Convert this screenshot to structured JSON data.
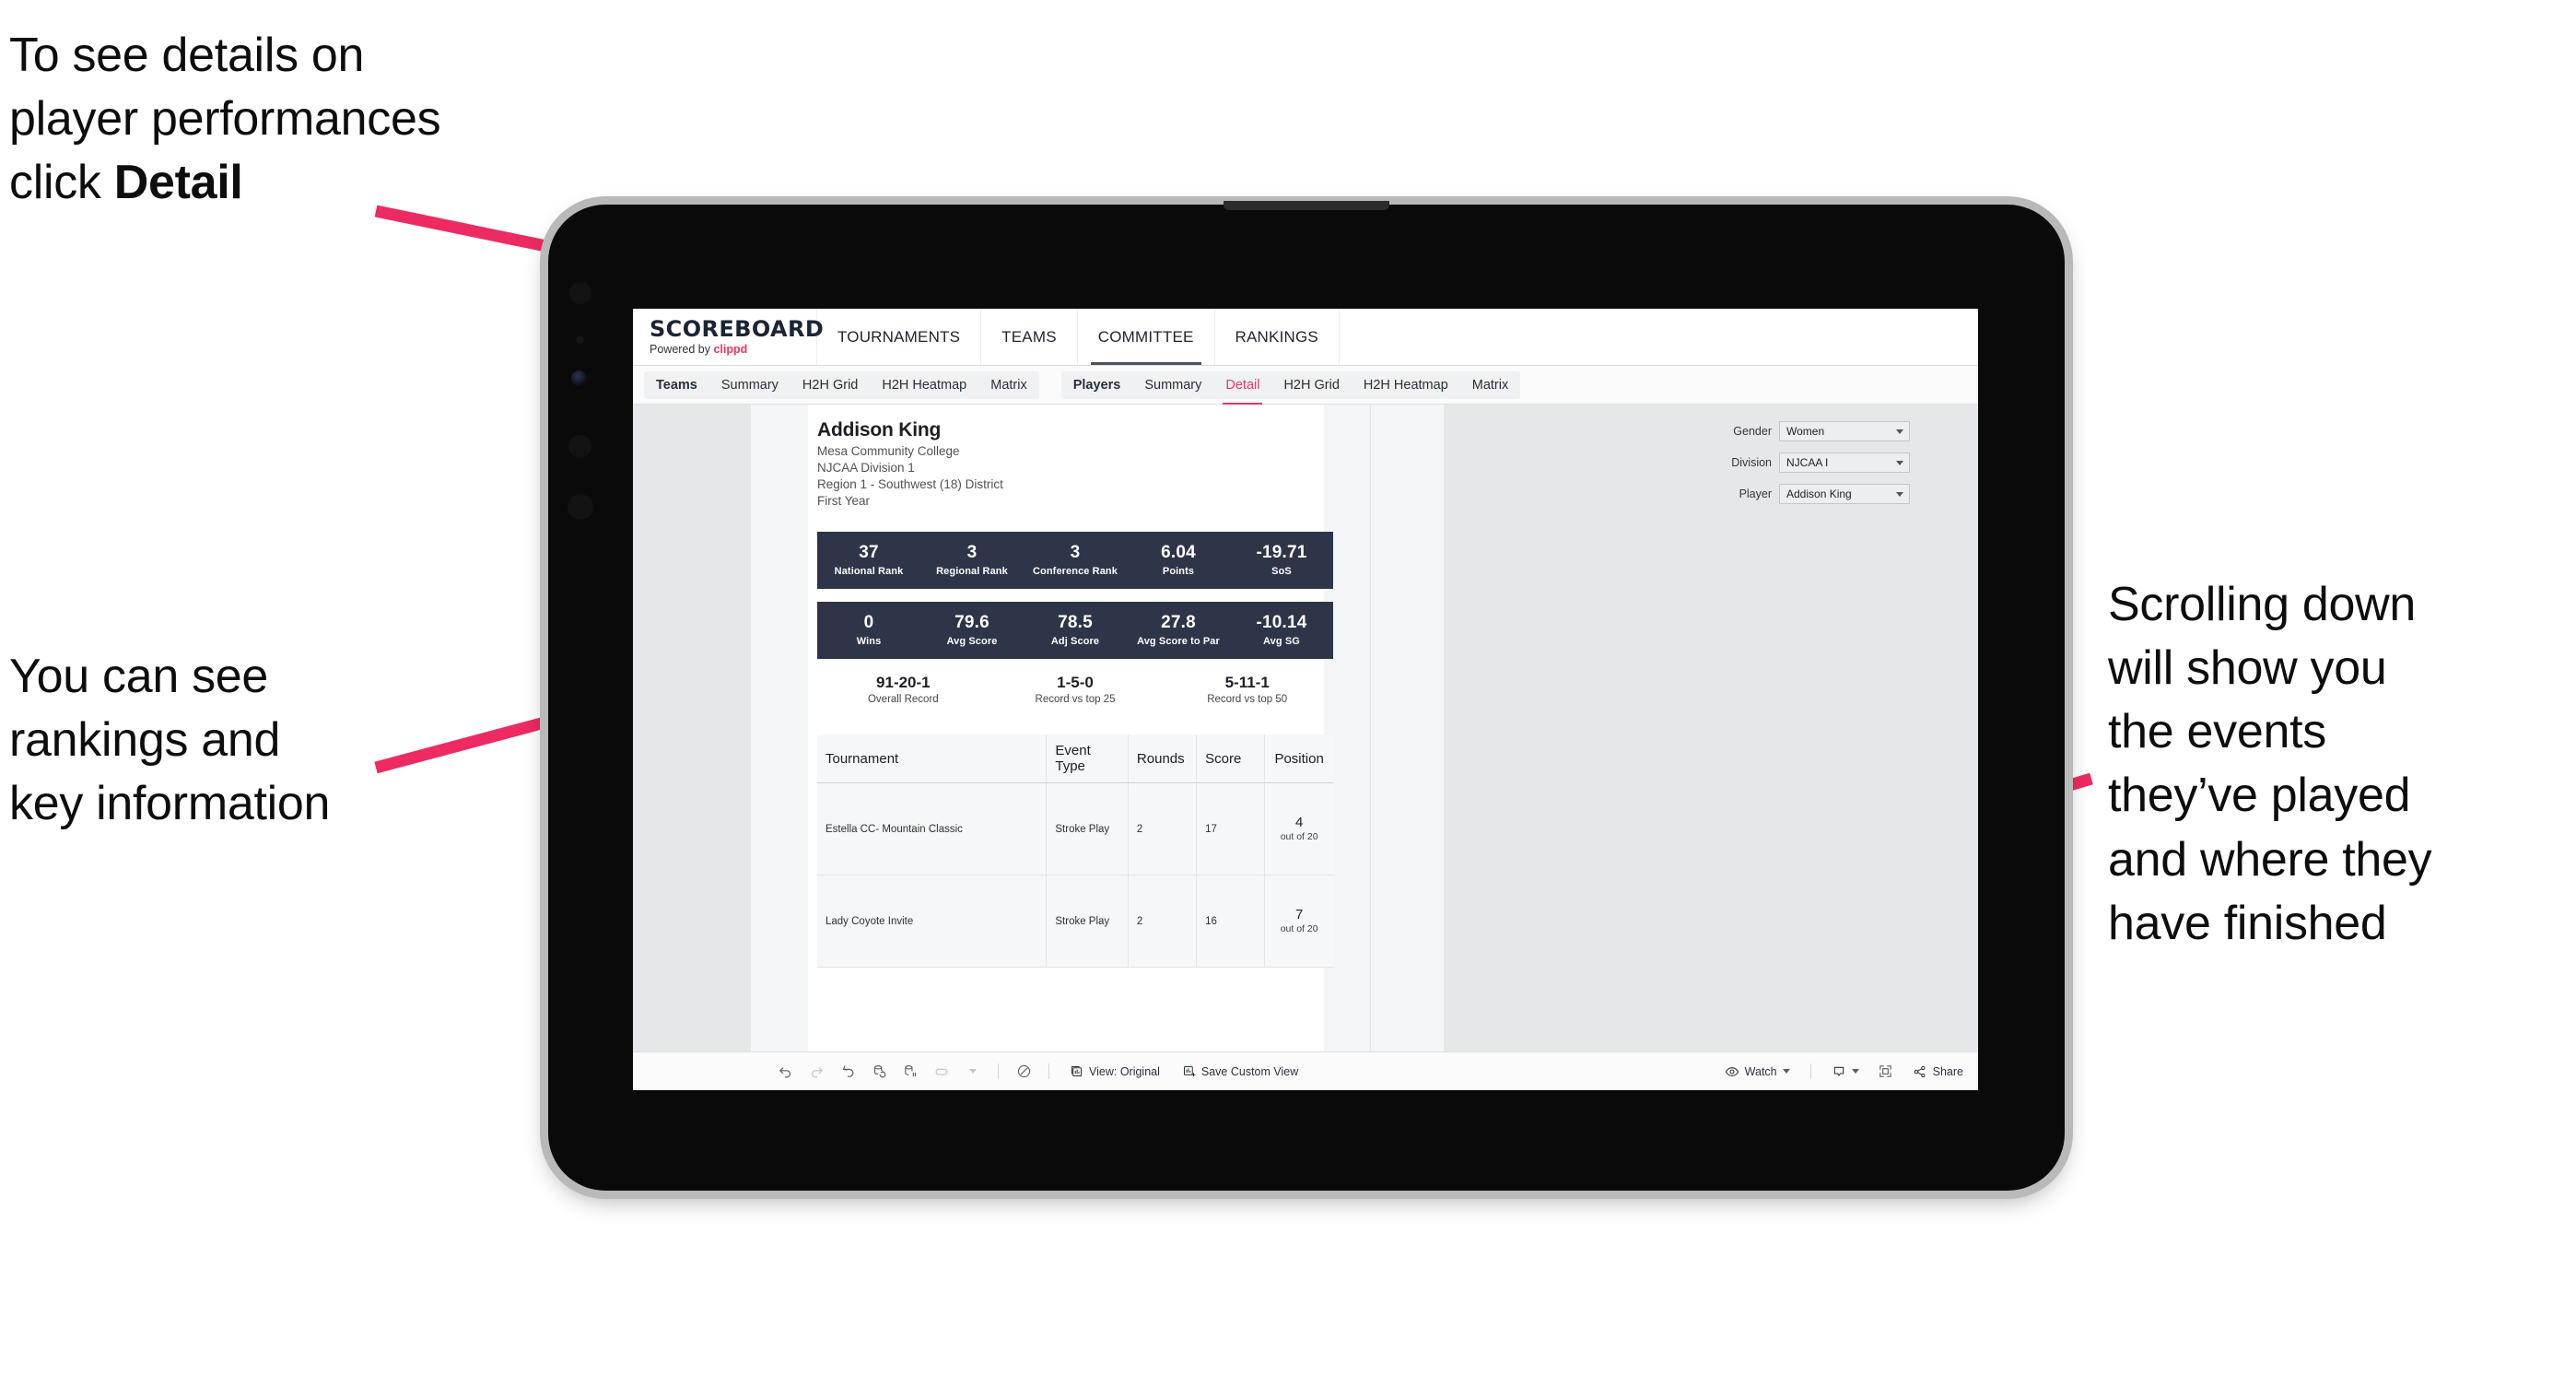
{
  "annotations": {
    "top_left": "To see details on\nplayer performances\nclick ",
    "top_left_bold": "Detail",
    "bottom_left": "You can see\nrankings and\nkey information",
    "right": "Scrolling down\nwill show you\nthe events\nthey’ve played\nand where they\nhave finished"
  },
  "brand": {
    "logo": "SCOREBOARD",
    "powered_prefix": "Powered by ",
    "powered_brand": "clippd"
  },
  "topnav": [
    {
      "label": "TOURNAMENTS",
      "selected": false
    },
    {
      "label": "TEAMS",
      "selected": false
    },
    {
      "label": "COMMITTEE",
      "selected": true
    },
    {
      "label": "RANKINGS",
      "selected": false
    }
  ],
  "subnav": {
    "teams_group": [
      {
        "label": "Teams",
        "head": true,
        "active": false
      },
      {
        "label": "Summary",
        "head": false,
        "active": false
      },
      {
        "label": "H2H Grid",
        "head": false,
        "active": false
      },
      {
        "label": "H2H Heatmap",
        "head": false,
        "active": false
      },
      {
        "label": "Matrix",
        "head": false,
        "active": false
      }
    ],
    "players_group": [
      {
        "label": "Players",
        "head": true,
        "active": false
      },
      {
        "label": "Summary",
        "head": false,
        "active": false
      },
      {
        "label": "Detail",
        "head": false,
        "active": true
      },
      {
        "label": "H2H Grid",
        "head": false,
        "active": false
      },
      {
        "label": "H2H Heatmap",
        "head": false,
        "active": false
      },
      {
        "label": "Matrix",
        "head": false,
        "active": false
      }
    ]
  },
  "player": {
    "name": "Addison King",
    "school": "Mesa Community College",
    "division": "NJCAA Division 1",
    "region": "Region 1 - Southwest (18) District",
    "year": "First Year"
  },
  "filters": [
    {
      "label": "Gender",
      "value": "Women"
    },
    {
      "label": "Division",
      "value": "NJCAA I"
    },
    {
      "label": "Player",
      "value": "Addison King"
    }
  ],
  "stats_row1": [
    {
      "value": "37",
      "label": "National Rank"
    },
    {
      "value": "3",
      "label": "Regional Rank"
    },
    {
      "value": "3",
      "label": "Conference Rank"
    },
    {
      "value": "6.04",
      "label": "Points"
    },
    {
      "value": "-19.71",
      "label": "SoS"
    }
  ],
  "stats_row2": [
    {
      "value": "0",
      "label": "Wins"
    },
    {
      "value": "79.6",
      "label": "Avg Score"
    },
    {
      "value": "78.5",
      "label": "Adj Score"
    },
    {
      "value": "27.8",
      "label": "Avg Score to Par"
    },
    {
      "value": "-10.14",
      "label": "Avg SG"
    }
  ],
  "records": [
    {
      "value": "91-20-1",
      "label": "Overall Record"
    },
    {
      "value": "1-5-0",
      "label": "Record vs top 25"
    },
    {
      "value": "5-11-1",
      "label": "Record vs top 50"
    }
  ],
  "table": {
    "columns": [
      "Tournament",
      "Event Type",
      "Rounds",
      "Score",
      "Position"
    ],
    "rows": [
      {
        "tournament": "Estella CC- Mountain Classic",
        "event_type": "Stroke Play",
        "rounds": "2",
        "score": "17",
        "position_num": "4",
        "position_of": "out of 20"
      },
      {
        "tournament": "Lady Coyote Invite",
        "event_type": "Stroke Play",
        "rounds": "2",
        "score": "16",
        "position_num": "7",
        "position_of": "out of 20"
      }
    ]
  },
  "toolbar": {
    "view_label": "View: Original",
    "save_label": "Save Custom View",
    "watch_label": "Watch",
    "share_label": "Share"
  },
  "colors": {
    "accent_pink": "#e4386a",
    "annotation_arrow": "#ed2a61",
    "stat_bar": "#2e3549",
    "brand_red": "#f0345c"
  }
}
